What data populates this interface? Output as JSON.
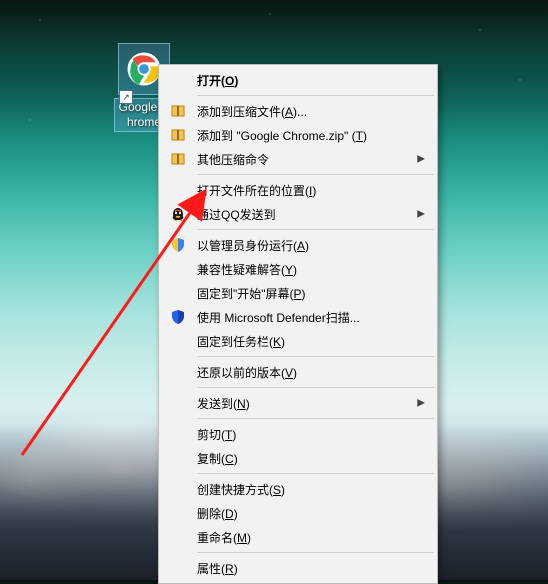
{
  "desktop_icon": {
    "label": "Google Chrome"
  },
  "context_menu": {
    "open": {
      "label": "打开",
      "access": "O"
    },
    "add_to_archive": {
      "label": "添加到压缩文件",
      "access": "A",
      "suffix": "..."
    },
    "add_to_named_zip": {
      "prefix": "添加到 \"",
      "filename": "Google Chrome.zip",
      "suffix": "\" ",
      "access": "T"
    },
    "other_compress": {
      "label": "其他压缩命令",
      "has_submenu": true
    },
    "open_file_location": {
      "label": "打开文件所在的位置",
      "access": "I"
    },
    "qq_send": {
      "label": "通过QQ发送到",
      "has_submenu": true
    },
    "run_as_admin": {
      "label": "以管理员身份运行",
      "access": "A"
    },
    "compat_troubleshoot": {
      "label": "兼容性疑难解答",
      "access": "Y"
    },
    "pin_to_start": {
      "label": "固定到\"开始\"屏幕",
      "access": "P"
    },
    "defender_scan": {
      "label": "使用 Microsoft Defender扫描..."
    },
    "pin_to_taskbar": {
      "label": "固定到任务栏",
      "access": "K"
    },
    "restore_previous": {
      "label": "还原以前的版本",
      "access": "V"
    },
    "send_to": {
      "label": "发送到",
      "access": "N",
      "has_submenu": true
    },
    "cut": {
      "label": "剪切",
      "access": "T"
    },
    "copy": {
      "label": "复制",
      "access": "C"
    },
    "create_shortcut": {
      "label": "创建快捷方式",
      "access": "S"
    },
    "delete": {
      "label": "删除",
      "access": "D"
    },
    "rename": {
      "label": "重命名",
      "access": "M"
    },
    "properties": {
      "label": "属性",
      "access": "R"
    }
  }
}
